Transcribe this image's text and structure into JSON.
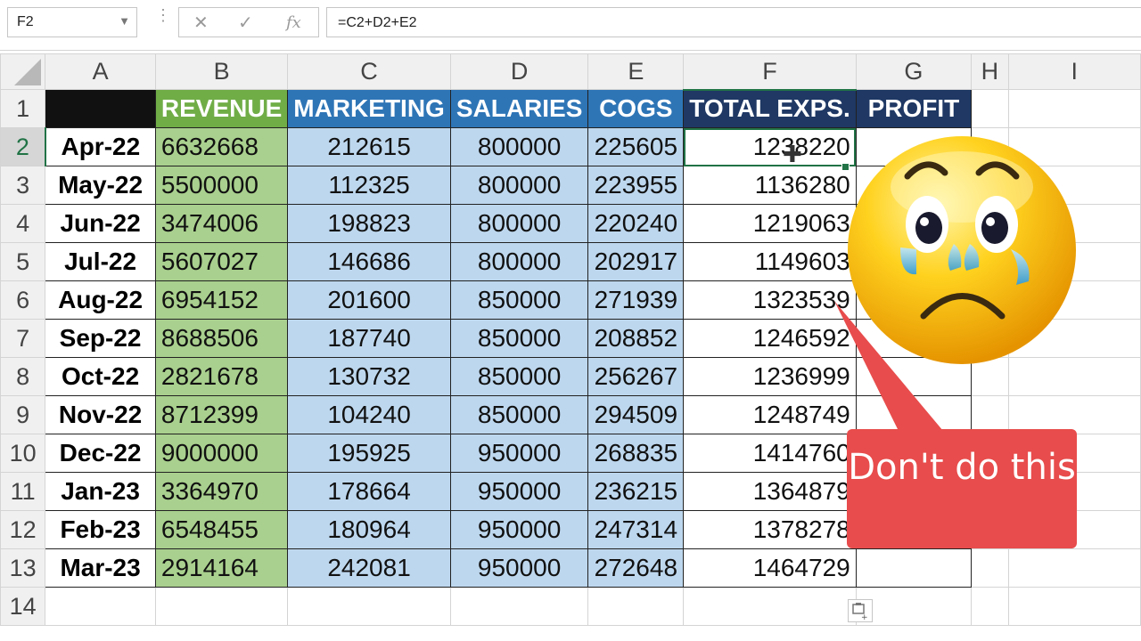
{
  "formula_bar": {
    "name_box": "F2",
    "formula": "=C2+D2+E2"
  },
  "columns": [
    "A",
    "B",
    "C",
    "D",
    "E",
    "F",
    "G",
    "H",
    "I"
  ],
  "selected_column": "F",
  "selected_row": "2",
  "headers": {
    "A": "",
    "B": "REVENUE",
    "C": "MARKETING",
    "D": "SALARIES",
    "E": "COGS",
    "F": "TOTAL EXPS.",
    "G": "PROFIT"
  },
  "rows": [
    {
      "n": "2",
      "date": "Apr-22",
      "revenue": "6632668",
      "marketing": "212615",
      "salaries": "800000",
      "cogs": "225605",
      "total": "1238220"
    },
    {
      "n": "3",
      "date": "May-22",
      "revenue": "5500000",
      "marketing": "112325",
      "salaries": "800000",
      "cogs": "223955",
      "total": "1136280"
    },
    {
      "n": "4",
      "date": "Jun-22",
      "revenue": "3474006",
      "marketing": "198823",
      "salaries": "800000",
      "cogs": "220240",
      "total": "1219063"
    },
    {
      "n": "5",
      "date": "Jul-22",
      "revenue": "5607027",
      "marketing": "146686",
      "salaries": "800000",
      "cogs": "202917",
      "total": "1149603"
    },
    {
      "n": "6",
      "date": "Aug-22",
      "revenue": "6954152",
      "marketing": "201600",
      "salaries": "850000",
      "cogs": "271939",
      "total": "1323539"
    },
    {
      "n": "7",
      "date": "Sep-22",
      "revenue": "8688506",
      "marketing": "187740",
      "salaries": "850000",
      "cogs": "208852",
      "total": "1246592"
    },
    {
      "n": "8",
      "date": "Oct-22",
      "revenue": "2821678",
      "marketing": "130732",
      "salaries": "850000",
      "cogs": "256267",
      "total": "1236999"
    },
    {
      "n": "9",
      "date": "Nov-22",
      "revenue": "8712399",
      "marketing": "104240",
      "salaries": "850000",
      "cogs": "294509",
      "total": "1248749"
    },
    {
      "n": "10",
      "date": "Dec-22",
      "revenue": "9000000",
      "marketing": "195925",
      "salaries": "950000",
      "cogs": "268835",
      "total": "1414760"
    },
    {
      "n": "11",
      "date": "Jan-23",
      "revenue": "3364970",
      "marketing": "178664",
      "salaries": "950000",
      "cogs": "236215",
      "total": "1364879"
    },
    {
      "n": "12",
      "date": "Feb-23",
      "revenue": "6548455",
      "marketing": "180964",
      "salaries": "950000",
      "cogs": "247314",
      "total": "1378278"
    },
    {
      "n": "13",
      "date": "Mar-23",
      "revenue": "2914164",
      "marketing": "242081",
      "salaries": "950000",
      "cogs": "272648",
      "total": "1464729"
    }
  ],
  "callout": {
    "text": "Don't do this",
    "color": "#e84c4c"
  },
  "colors": {
    "revenue_header": "#70ad47",
    "revenue_fill": "#a9d08e",
    "expense_header": "#2e75b6",
    "expense_fill": "#bdd7ee",
    "total_header": "#1f3864",
    "selection": "#217346"
  },
  "icons": {
    "emoji": "crying-face-icon",
    "paste_options": "paste-options-icon",
    "cursor": "cell-select-cursor-icon"
  }
}
